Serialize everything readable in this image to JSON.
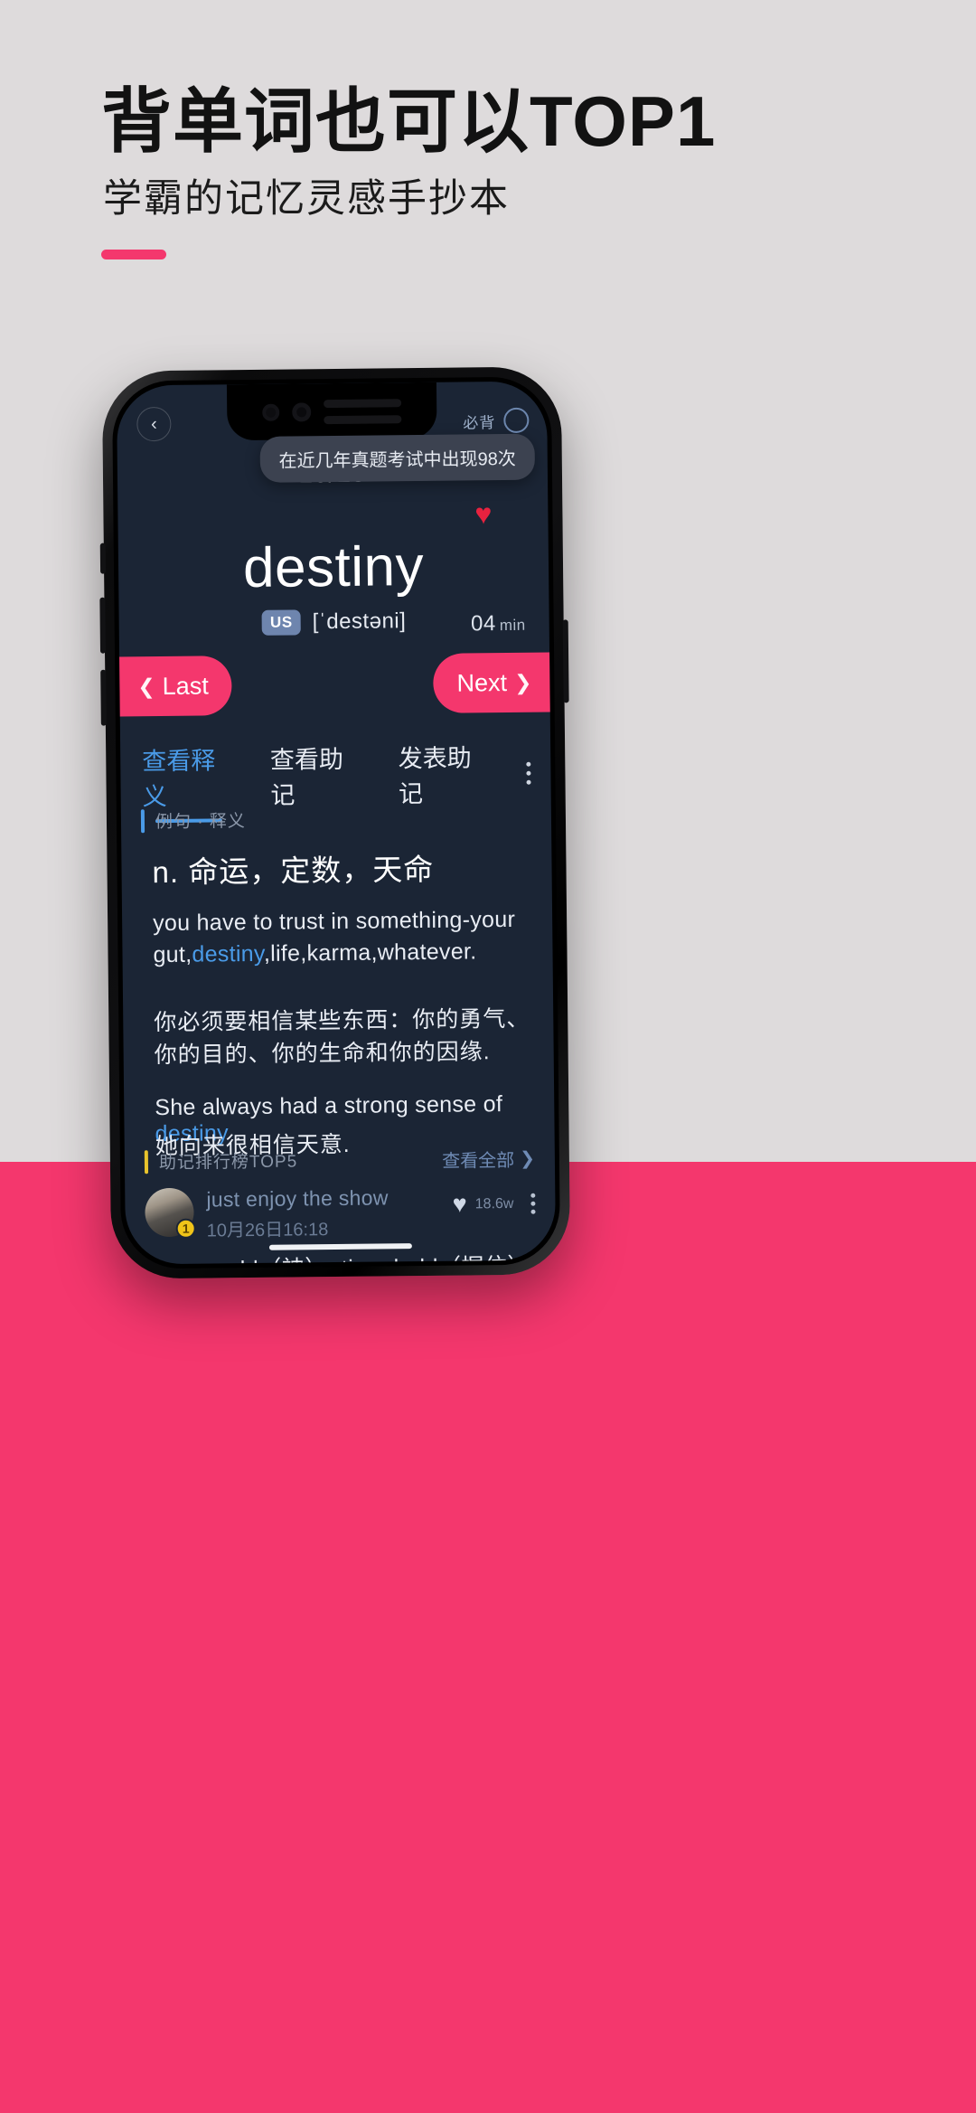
{
  "poster": {
    "headline_prefix": "背单词也可以",
    "headline_highlight": "TOP1",
    "subhead": "学霸的记忆灵感手抄本",
    "accent_color": "#f4376d",
    "bg_top_color": "#dedbdc",
    "bg_bottom_color": "#f4376d"
  },
  "app": {
    "appbar": {
      "back_icon": "chevron-left-icon",
      "right_label": "必背",
      "right_icon": "circle-outline-icon"
    },
    "tooltip": "在近几年真题考试中出现98次",
    "day_counter": "10/15",
    "favorite_icon": "heart-filled-icon",
    "word": "destiny",
    "accent_color": "#4a9be8",
    "pronunciation": {
      "badge": "US",
      "phonetic": "[ˈdestəni]"
    },
    "timer": {
      "value": "04",
      "unit": "min"
    },
    "nav": {
      "prev_label": "Last",
      "next_label": "Next"
    },
    "tabs": [
      {
        "label": "查看释义",
        "active": true
      },
      {
        "label": "查看助记",
        "active": false
      },
      {
        "label": "发表助记",
        "active": false
      }
    ],
    "more_icon": "kebab-menu-icon",
    "definition_section": {
      "label": "例句 · 释义",
      "definition": "n. 命运，定数，天命",
      "example_1": {
        "en_before": "you have to trust in something-your gut,",
        "en_highlight": "destiny",
        "en_after": ",life,karma,whatever.",
        "cn": "你必须要相信某些东西：你的勇气、你的目的、你的生命和你的因缘."
      },
      "example_2": {
        "en_before": "She always had a strong sense of ",
        "en_highlight": "destiny",
        "en_after": " .",
        "cn": "她向来很相信天意."
      }
    },
    "ranking_section": {
      "label": "助记排行榜TOP5",
      "view_all": "查看全部",
      "view_all_icon": "chevron-right-icon",
      "comment": {
        "author": "just enjoy the show",
        "timestamp": "10月26日16:18",
        "rank_badge": "1",
        "like_icon": "heart-filled-icon",
        "like_count": "18.6w",
        "more_icon": "kebab-menu-icon",
        "body": "des = gold（神）+tin = hold（握住）+ y(名次后缀)，构成抽象名次->由神决定的->命运；"
      }
    }
  }
}
